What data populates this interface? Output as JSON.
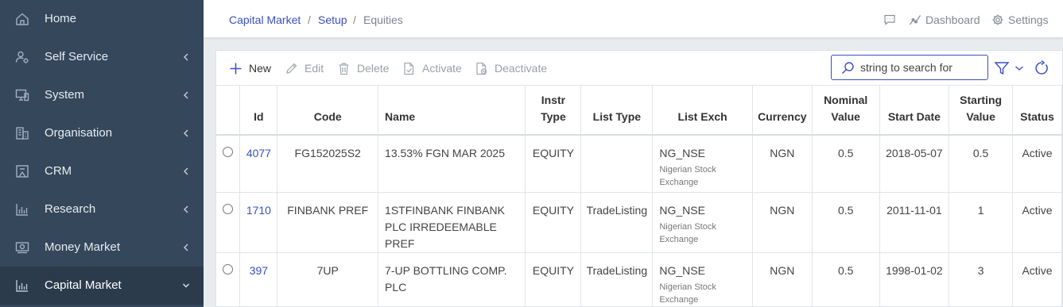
{
  "sidebar": {
    "items": [
      {
        "label": "Home",
        "icon": "home-icon",
        "has_chevron": false
      },
      {
        "label": "Self Service",
        "icon": "user-gear-icon",
        "has_chevron": true
      },
      {
        "label": "System",
        "icon": "monitor-icon",
        "has_chevron": true
      },
      {
        "label": "Organisation",
        "icon": "building-icon",
        "has_chevron": true
      },
      {
        "label": "CRM",
        "icon": "frame-icon",
        "has_chevron": true
      },
      {
        "label": "Research",
        "icon": "bar-chart-icon",
        "has_chevron": true
      },
      {
        "label": "Money Market",
        "icon": "money-icon",
        "has_chevron": true
      },
      {
        "label": "Capital Market",
        "icon": "bar-chart-icon",
        "has_chevron": true,
        "expanded": true,
        "active": true
      }
    ]
  },
  "breadcrumb": {
    "items": [
      "Capital Market",
      "Setup",
      "Equities"
    ],
    "separator": "/"
  },
  "header_actions": {
    "comment_icon": "comment-icon",
    "dashboard": "Dashboard",
    "settings": "Settings"
  },
  "toolbar": {
    "new": "New",
    "edit": "Edit",
    "delete": "Delete",
    "activate": "Activate",
    "deactivate": "Deactivate"
  },
  "search": {
    "placeholder": "string to search for"
  },
  "table": {
    "columns": [
      "",
      "Id",
      "Code",
      "Name",
      "Instr Type",
      "List Type",
      "List Exch",
      "Currency",
      "Nominal Value",
      "Start Date",
      "Starting Value",
      "Status"
    ],
    "rows": [
      {
        "id": "4077",
        "code": "FG152025S2",
        "name": "13.53% FGN MAR 2025",
        "instr_type": "EQUITY",
        "list_type": "",
        "list_exch": "NG_NSE",
        "list_exch_name": "Nigerian Stock Exchange",
        "currency": "NGN",
        "nominal_value": "0.5",
        "start_date": "2018-05-07",
        "starting_value": "0.5",
        "status": "Active"
      },
      {
        "id": "1710",
        "code": "FINBANK PREF",
        "name": "1STFINBANK FINBANK PLC IRREDEEMABLE PREF",
        "instr_type": "EQUITY",
        "list_type": "TradeListing",
        "list_exch": "NG_NSE",
        "list_exch_name": "Nigerian Stock Exchange",
        "currency": "NGN",
        "nominal_value": "0.5",
        "start_date": "2011-11-01",
        "starting_value": "1",
        "status": "Active"
      },
      {
        "id": "397",
        "code": "7UP",
        "name": "7-UP BOTTLING COMP. PLC",
        "instr_type": "EQUITY",
        "list_type": "TradeListing",
        "list_exch": "NG_NSE",
        "list_exch_name": "Nigerian Stock Exchange",
        "currency": "NGN",
        "nominal_value": "0.5",
        "start_date": "1998-01-02",
        "starting_value": "3",
        "status": "Active"
      }
    ]
  },
  "colors": {
    "sidebar_bg": "#35475b",
    "sidebar_active_bg": "#2b3b4c",
    "accent": "#3a4fc0",
    "page_bg": "#e9ecef"
  }
}
